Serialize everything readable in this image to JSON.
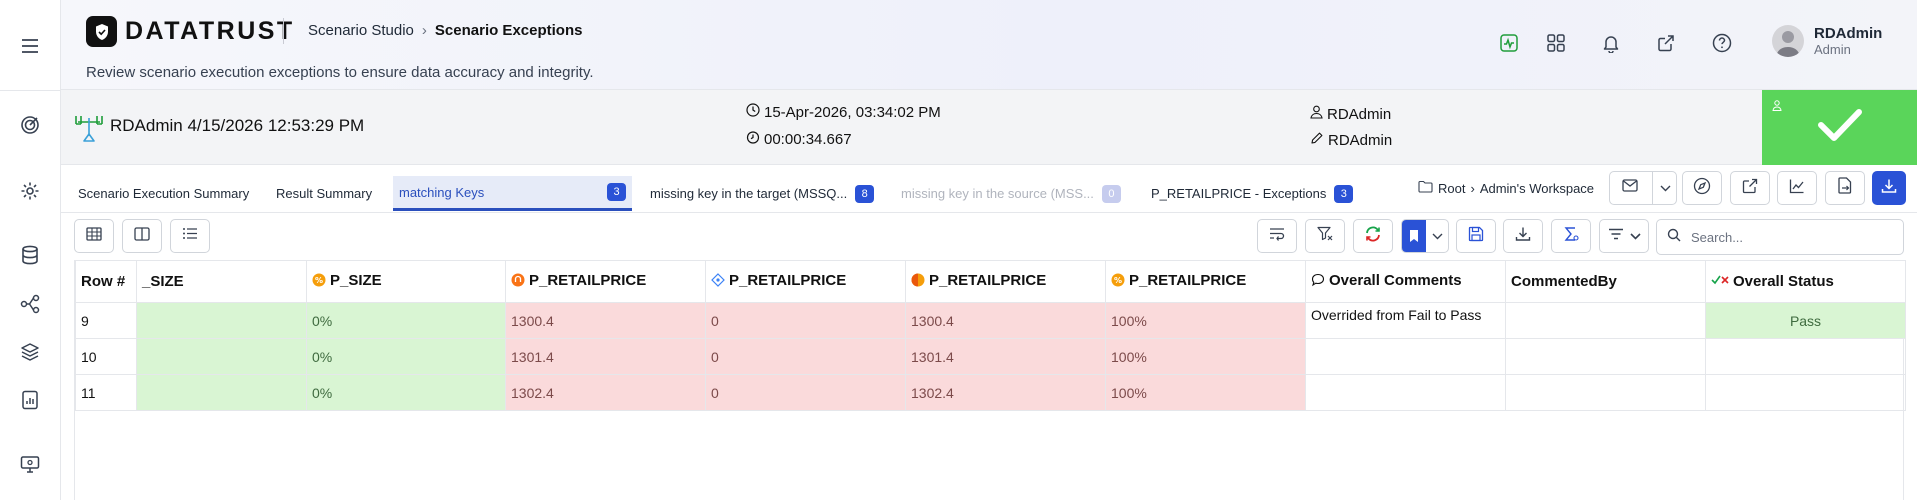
{
  "header": {
    "logo_text": "DATATRUST",
    "breadcrumb": {
      "parent": "Scenario Studio",
      "current": "Scenario Exceptions"
    },
    "subtitle": "Review scenario execution exceptions to ensure data accuracy and integrity.",
    "icons": [
      "activity-icon",
      "apps-grid-icon",
      "bell-icon",
      "external-link-icon",
      "help-icon"
    ],
    "user": {
      "name": "RDAdmin",
      "role": "Admin"
    }
  },
  "info": {
    "run_title": "RDAdmin 4/15/2026 12:53:29 PM",
    "start_time": "15-Apr-2026, 03:34:02 PM",
    "duration": "00:00:34.667",
    "created_by": "RDAdmin",
    "edited_by": "RDAdmin",
    "status_color": "#5ad55a"
  },
  "tabs": [
    {
      "label": "Scenario Execution Summary",
      "badge": ""
    },
    {
      "label": "Result Summary",
      "badge": ""
    },
    {
      "label": "matching Keys",
      "badge": "3"
    },
    {
      "label": "missing key in the target (MSSQ...",
      "badge": "8"
    },
    {
      "label": "missing key in the source (MSS...",
      "badge": "0"
    },
    {
      "label": "P_RETAILPRICE - Exceptions",
      "badge": "3"
    }
  ],
  "workspace_path": {
    "root": "Root",
    "workspace": "Admin's Workspace"
  },
  "search": {
    "placeholder": "Search..."
  },
  "grid": {
    "columns": [
      "Row #",
      "_SIZE",
      "P_SIZE",
      "P_RETAILPRICE",
      "P_RETAILPRICE",
      "P_RETAILPRICE",
      "P_RETAILPRICE",
      "Overall Comments",
      "CommentedBy",
      "Overall Status"
    ],
    "rows": [
      {
        "row": "9",
        "size": "",
        "p_size": "0%",
        "price_a": "1300.4",
        "price_b": "0",
        "price_c": "1300.4",
        "price_d": "100%",
        "comment": "Overrided from Fail to Pass",
        "commented_by": "",
        "status": "Pass"
      },
      {
        "row": "10",
        "size": "",
        "p_size": "0%",
        "price_a": "1301.4",
        "price_b": "0",
        "price_c": "1301.4",
        "price_d": "100%",
        "comment": "",
        "commented_by": "",
        "status": ""
      },
      {
        "row": "11",
        "size": "",
        "p_size": "0%",
        "price_a": "1302.4",
        "price_b": "0",
        "price_c": "1302.4",
        "price_d": "100%",
        "comment": "",
        "commented_by": "",
        "status": ""
      }
    ]
  },
  "colors": {
    "accent": "#2a52d6",
    "match": "#d9f5d3",
    "mismatch": "#fadadb"
  }
}
